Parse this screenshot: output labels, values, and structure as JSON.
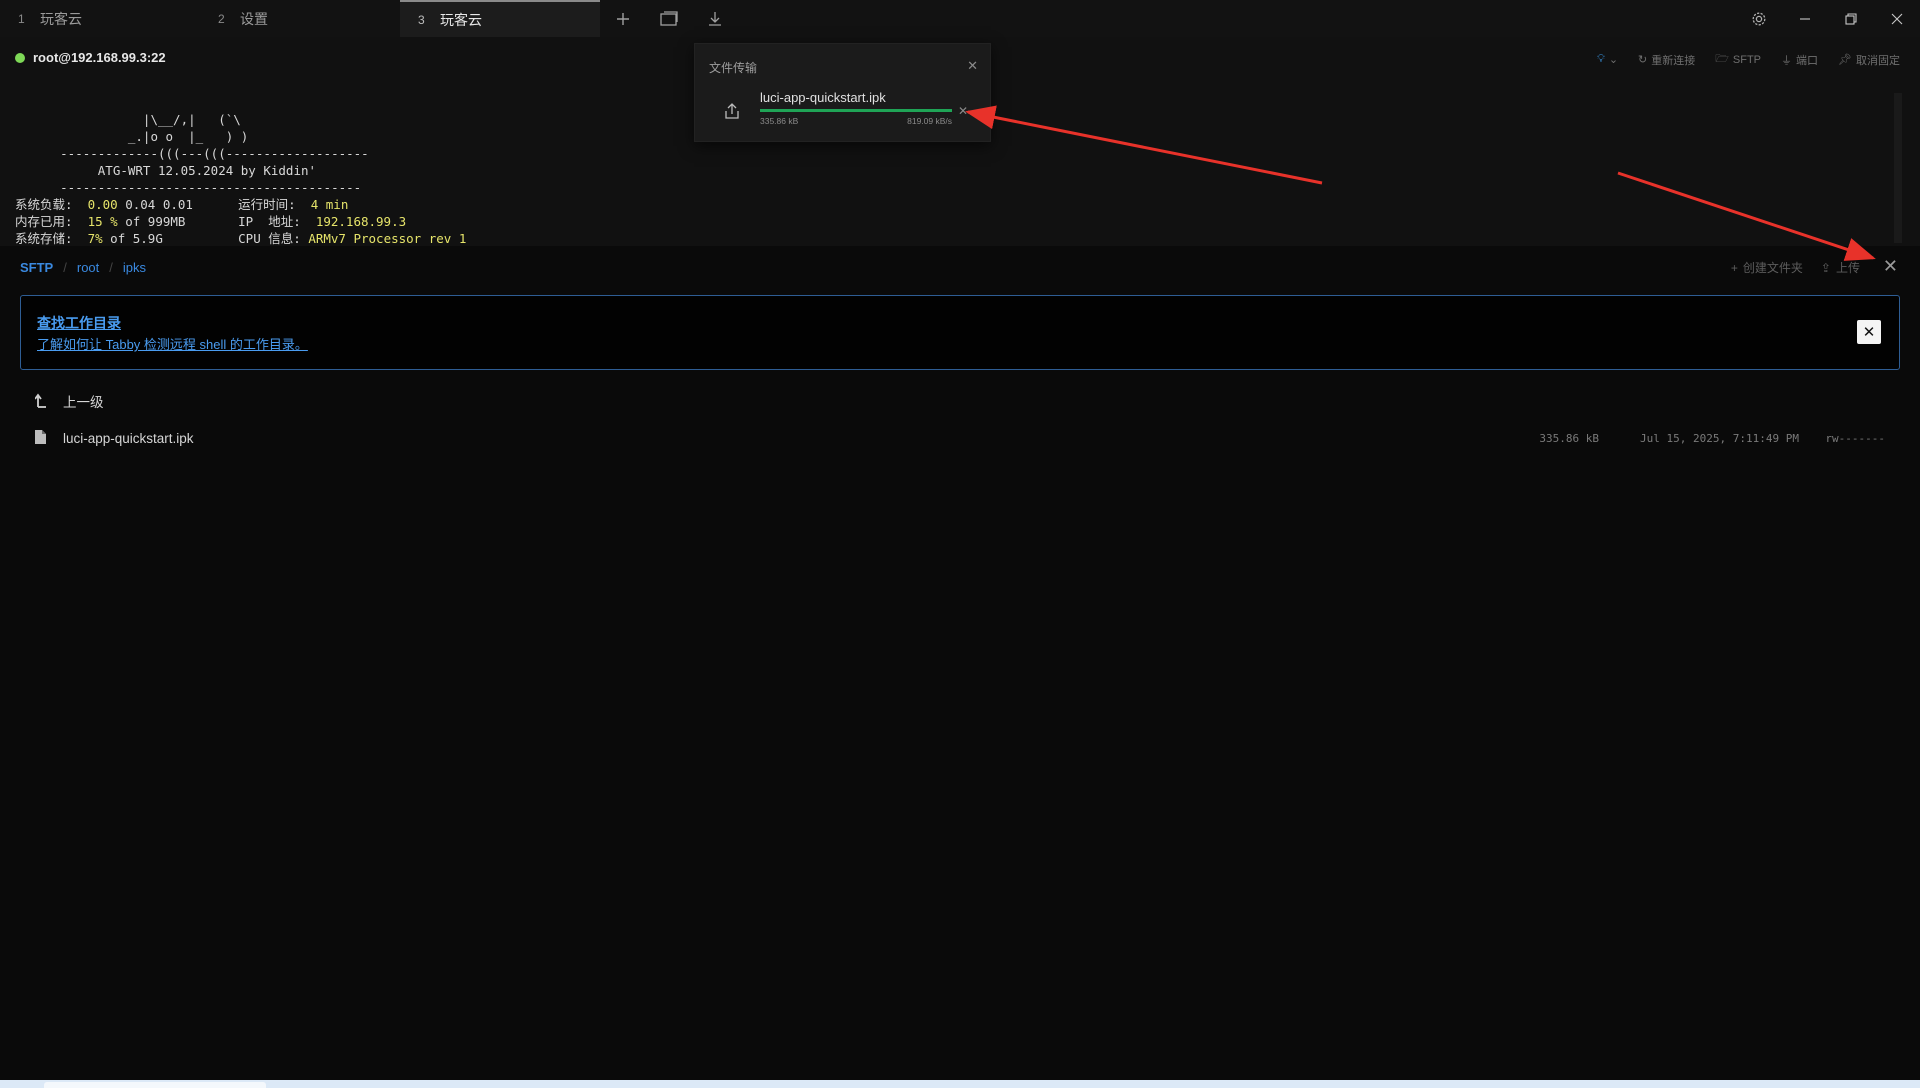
{
  "tabs": [
    {
      "num": "1",
      "label": "玩客云"
    },
    {
      "num": "2",
      "label": "设置"
    },
    {
      "num": "3",
      "label": "玩客云"
    }
  ],
  "terminal": {
    "connection": "root@192.168.99.3:22",
    "tools": {
      "reconnect": "重新连接",
      "sftp": "SFTP",
      "ports": "端口",
      "unpin": "取消固定"
    },
    "banner_lines": [
      "                 |\\__/,|   (`\\",
      "               _.|o o  |_   ) )",
      "      -------------(((---(((-------------------",
      "           ATG-WRT 12.05.2024 by Kiddin'",
      "      ----------------------------------------"
    ],
    "stats": [
      {
        "label": "系统负载:",
        "value_hl": "0.00",
        "value_rest": " 0.04 0.01",
        "label2": "运行时间:",
        "value2": "4 min"
      },
      {
        "label": "内存已用:",
        "value_hl": "15 %",
        "value_rest": " of 999MB",
        "label2": "IP  地址:",
        "value2": "192.168.99.3"
      },
      {
        "label": "系统存储:",
        "value_hl": "7%",
        "value_rest": " of 5.9G",
        "label2": "CPU 信息:",
        "value2": "ARMv7 Processor rev 1"
      }
    ]
  },
  "transfer": {
    "title": "文件传输",
    "file_name": "luci-app-quickstart.ipk",
    "size": "335.86 kB",
    "speed": "819.09 kB/s",
    "progress": 1.0
  },
  "sftp": {
    "breadcrumb": [
      "SFTP",
      "root",
      "ipks"
    ],
    "create_folder": "创建文件夹",
    "upload": "上传",
    "banner": {
      "title": "查找工作目录",
      "text": "了解如何让 Tabby 检测远程 shell 的工作目录。"
    },
    "parent_label": "上一级",
    "files": [
      {
        "name": "luci-app-quickstart.ipk",
        "size": "335.86 kB",
        "date": "Jul 15, 2025, 7:11:49 PM",
        "perm": "rw-------"
      }
    ]
  },
  "colors": {
    "accent": "#3a89e0",
    "progress": "#1fa456",
    "status_ok": "#7ed957",
    "arrow": "#e8322a"
  }
}
